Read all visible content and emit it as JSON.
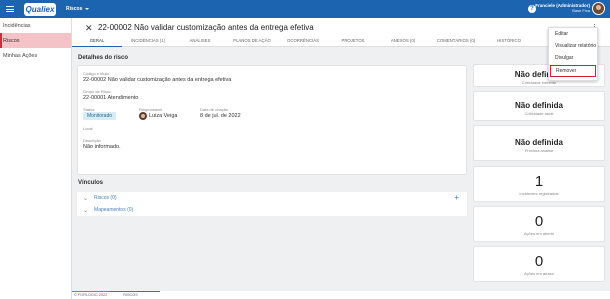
{
  "topbar": {
    "logo_text": "Qualiex",
    "module": "Riscos",
    "help": "?",
    "user_name": "Franciele (Administrador)",
    "user_sub": "Base Fixa"
  },
  "sidebar": {
    "items": [
      {
        "label": "Incidências"
      },
      {
        "label": "Riscos"
      },
      {
        "label": "Minhas Ações"
      }
    ]
  },
  "header": {
    "title": "22-00002 Não validar customização antes da entrega efetiva",
    "tabs": [
      {
        "label": "Geral"
      },
      {
        "label": "Incidências (1)"
      },
      {
        "label": "Análises"
      },
      {
        "label": "Planos de ação"
      },
      {
        "label": "Ocorrências"
      },
      {
        "label": "Projetos"
      },
      {
        "label": "Anexos (0)"
      },
      {
        "label": "Comentários (0)"
      },
      {
        "label": "Histórico"
      }
    ]
  },
  "details": {
    "section_title": "Detalhes do risco",
    "code_label": "Código e título",
    "code_value": "22-00002 Não validar customização antes da entrega efetiva",
    "group_label": "Grupo de Risco",
    "group_value": "22-00001 Atendimento",
    "status_label": "Status",
    "status_value": "Monitorado",
    "resp_label": "Responsável",
    "resp_value": "Luiza Veiga",
    "date_label": "Data de criação",
    "date_value": "8 de jul. de 2022",
    "local_label": "Local",
    "desc_label": "Descrição",
    "desc_value": "Não informado."
  },
  "vinculos": {
    "section_title": "Vínculos",
    "items": [
      {
        "label": "Riscos (0)"
      },
      {
        "label": "Mapeamentos (0)"
      }
    ]
  },
  "stats": [
    {
      "value": "Não definido",
      "label": "Criticidade inerente"
    },
    {
      "value": "Não definida",
      "label": "Criticidade atual"
    },
    {
      "value": "Não definida",
      "label": "Próxima análise"
    },
    {
      "value": "1",
      "label": "Incidentes registrados"
    },
    {
      "value": "0",
      "label": "Ações em aberto"
    },
    {
      "value": "0",
      "label": "Ações em atraso"
    }
  ],
  "menu": {
    "items": [
      {
        "label": "Editar"
      },
      {
        "label": "Visualizar relatório"
      },
      {
        "label": "Divulgar"
      },
      {
        "label": "Remover"
      }
    ]
  },
  "footer": {
    "copyright": "© FORLOGIC 2022",
    "module": "RISCOS"
  },
  "colors": {
    "brand": "#1d64b0",
    "active_sidebar": "#f4c3c8",
    "highlight_border": "#d3222f"
  }
}
